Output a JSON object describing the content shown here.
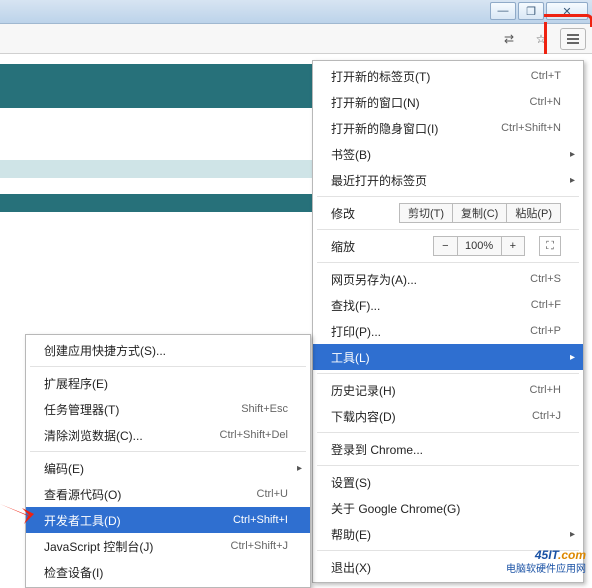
{
  "titlebar": {
    "min": "—",
    "max": "❐",
    "close": "✕"
  },
  "toolbar": {
    "translate": "⇄",
    "star": "☆",
    "menu": "≡"
  },
  "main_menu": {
    "new_tab": "打开新的标签页(T)",
    "new_tab_sc": "Ctrl+T",
    "new_window": "打开新的窗口(N)",
    "new_window_sc": "Ctrl+N",
    "incognito": "打开新的隐身窗口(I)",
    "incognito_sc": "Ctrl+Shift+N",
    "bookmarks": "书签(B)",
    "recent": "最近打开的标签页",
    "edit": "修改",
    "cut": "剪切(T)",
    "copy": "复制(C)",
    "paste": "粘贴(P)",
    "zoom": "缩放",
    "zoom_minus": "−",
    "zoom_val": "100%",
    "zoom_plus": "+",
    "zoom_fs": "⛶",
    "saveas": "网页另存为(A)...",
    "saveas_sc": "Ctrl+S",
    "find": "查找(F)...",
    "find_sc": "Ctrl+F",
    "print": "打印(P)...",
    "print_sc": "Ctrl+P",
    "tools": "工具(L)",
    "history": "历史记录(H)",
    "history_sc": "Ctrl+H",
    "downloads": "下载内容(D)",
    "downloads_sc": "Ctrl+J",
    "signin": "登录到 Chrome...",
    "settings": "设置(S)",
    "about": "关于 Google Chrome(G)",
    "help": "帮助(E)",
    "exit": "退出(X)"
  },
  "sub_menu": {
    "create_shortcut": "创建应用快捷方式(S)...",
    "extensions": "扩展程序(E)",
    "taskmgr": "任务管理器(T)",
    "taskmgr_sc": "Shift+Esc",
    "clear": "清除浏览数据(C)...",
    "clear_sc": "Ctrl+Shift+Del",
    "encoding": "编码(E)",
    "view_source": "查看源代码(O)",
    "view_source_sc": "Ctrl+U",
    "devtools": "开发者工具(D)",
    "devtools_sc": "Ctrl+Shift+I",
    "js_console": "JavaScript 控制台(J)",
    "js_console_sc": "Ctrl+Shift+J",
    "inspect": "检查设备(I)"
  },
  "watermark": {
    "brand_blue": "45IT",
    "brand_orange": ".com",
    "tag": "电脑软硬件应用网"
  }
}
